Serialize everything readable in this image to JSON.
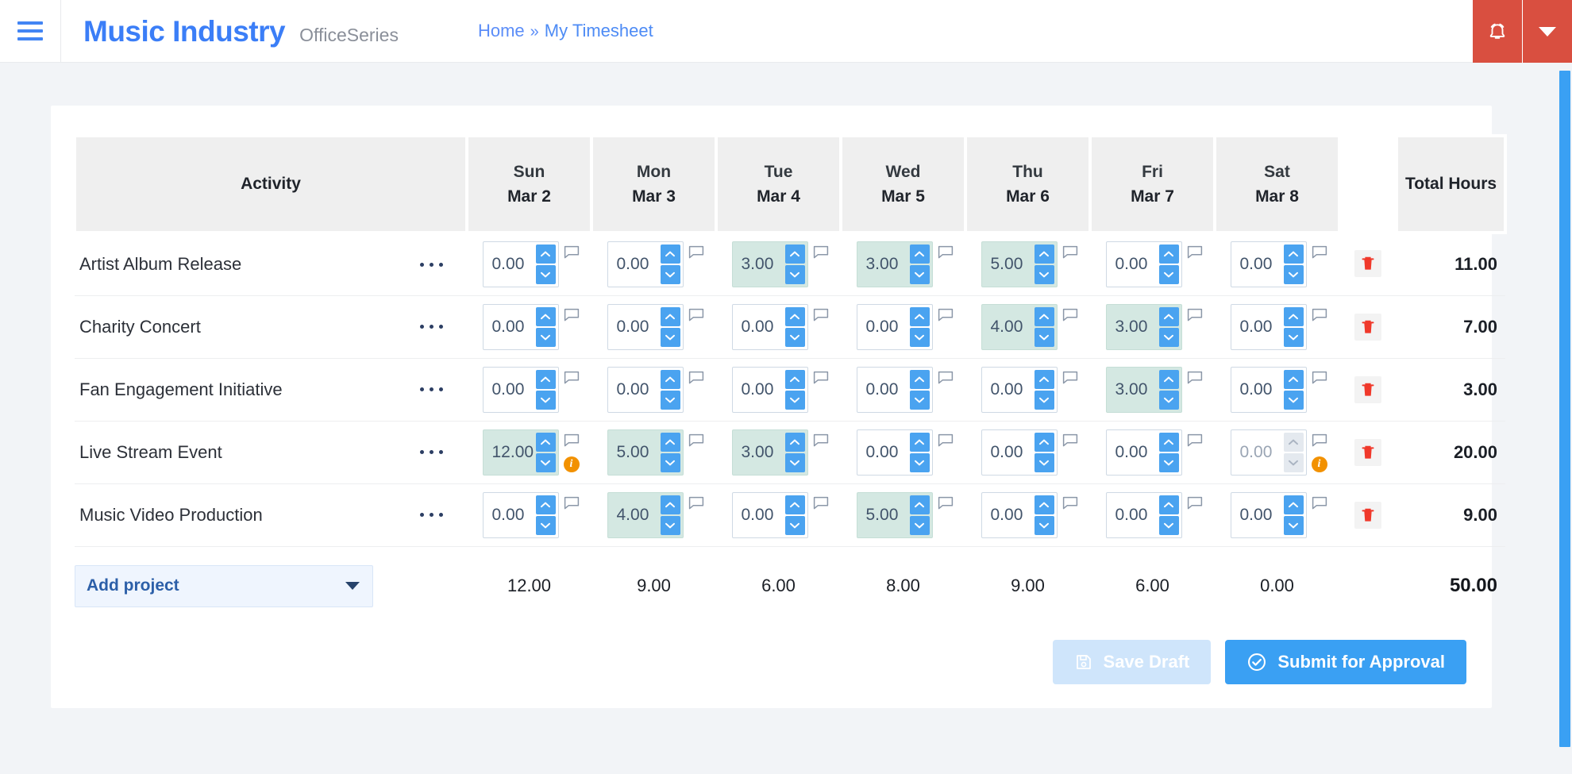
{
  "topbar": {
    "menu_icon": "hamburger-icon",
    "brand_title": "Music Industry",
    "brand_sub": "OfficeSeries",
    "breadcrumb": {
      "home": "Home",
      "separator": "»",
      "current": "My Timesheet"
    },
    "alert_icon": "alarm-bell-icon",
    "alert_caret_icon": "chevron-down-icon",
    "alert_color": "#d94f40"
  },
  "table": {
    "activity_header": "Activity",
    "total_header": "Total Hours",
    "days": [
      {
        "dow": "Sun",
        "date": "Mar 2"
      },
      {
        "dow": "Mon",
        "date": "Mar 3"
      },
      {
        "dow": "Tue",
        "date": "Mar 4"
      },
      {
        "dow": "Wed",
        "date": "Mar 5"
      },
      {
        "dow": "Thu",
        "date": "Mar 6"
      },
      {
        "dow": "Fri",
        "date": "Mar 7"
      },
      {
        "dow": "Sat",
        "date": "Mar 8"
      }
    ],
    "rows": [
      {
        "activity": "Artist Album Release",
        "hours": [
          {
            "value": "0.00",
            "filled": false,
            "disabled": false,
            "warn": false
          },
          {
            "value": "0.00",
            "filled": false,
            "disabled": false,
            "warn": false
          },
          {
            "value": "3.00",
            "filled": true,
            "disabled": false,
            "warn": false
          },
          {
            "value": "3.00",
            "filled": true,
            "disabled": false,
            "warn": false
          },
          {
            "value": "5.00",
            "filled": true,
            "disabled": false,
            "warn": false
          },
          {
            "value": "0.00",
            "filled": false,
            "disabled": false,
            "warn": false
          },
          {
            "value": "0.00",
            "filled": false,
            "disabled": false,
            "warn": false
          }
        ],
        "total": "11.00"
      },
      {
        "activity": "Charity Concert",
        "hours": [
          {
            "value": "0.00",
            "filled": false,
            "disabled": false,
            "warn": false
          },
          {
            "value": "0.00",
            "filled": false,
            "disabled": false,
            "warn": false
          },
          {
            "value": "0.00",
            "filled": false,
            "disabled": false,
            "warn": false
          },
          {
            "value": "0.00",
            "filled": false,
            "disabled": false,
            "warn": false
          },
          {
            "value": "4.00",
            "filled": true,
            "disabled": false,
            "warn": false
          },
          {
            "value": "3.00",
            "filled": true,
            "disabled": false,
            "warn": false
          },
          {
            "value": "0.00",
            "filled": false,
            "disabled": false,
            "warn": false
          }
        ],
        "total": "7.00"
      },
      {
        "activity": "Fan Engagement Initiative",
        "hours": [
          {
            "value": "0.00",
            "filled": false,
            "disabled": false,
            "warn": false
          },
          {
            "value": "0.00",
            "filled": false,
            "disabled": false,
            "warn": false
          },
          {
            "value": "0.00",
            "filled": false,
            "disabled": false,
            "warn": false
          },
          {
            "value": "0.00",
            "filled": false,
            "disabled": false,
            "warn": false
          },
          {
            "value": "0.00",
            "filled": false,
            "disabled": false,
            "warn": false
          },
          {
            "value": "3.00",
            "filled": true,
            "disabled": false,
            "warn": false
          },
          {
            "value": "0.00",
            "filled": false,
            "disabled": false,
            "warn": false
          }
        ],
        "total": "3.00"
      },
      {
        "activity": "Live Stream Event",
        "hours": [
          {
            "value": "12.00",
            "filled": true,
            "disabled": false,
            "warn": true
          },
          {
            "value": "5.00",
            "filled": true,
            "disabled": false,
            "warn": false
          },
          {
            "value": "3.00",
            "filled": true,
            "disabled": false,
            "warn": false
          },
          {
            "value": "0.00",
            "filled": false,
            "disabled": false,
            "warn": false
          },
          {
            "value": "0.00",
            "filled": false,
            "disabled": false,
            "warn": false
          },
          {
            "value": "0.00",
            "filled": false,
            "disabled": false,
            "warn": false
          },
          {
            "value": "0.00",
            "filled": false,
            "disabled": true,
            "warn": true
          }
        ],
        "total": "20.00"
      },
      {
        "activity": "Music Video Production",
        "hours": [
          {
            "value": "0.00",
            "filled": false,
            "disabled": false,
            "warn": false
          },
          {
            "value": "4.00",
            "filled": true,
            "disabled": false,
            "warn": false
          },
          {
            "value": "0.00",
            "filled": false,
            "disabled": false,
            "warn": false
          },
          {
            "value": "5.00",
            "filled": true,
            "disabled": false,
            "warn": false
          },
          {
            "value": "0.00",
            "filled": false,
            "disabled": false,
            "warn": false
          },
          {
            "value": "0.00",
            "filled": false,
            "disabled": false,
            "warn": false
          },
          {
            "value": "0.00",
            "filled": false,
            "disabled": false,
            "warn": false
          }
        ],
        "total": "9.00"
      }
    ],
    "footer": {
      "add_project_label": "Add project",
      "day_totals": [
        "12.00",
        "9.00",
        "6.00",
        "8.00",
        "9.00",
        "6.00",
        "0.00"
      ],
      "grand_total": "50.00"
    }
  },
  "actions": {
    "save_draft_label": "Save Draft",
    "save_draft_icon": "save-disk-icon",
    "save_draft_disabled": true,
    "submit_label": "Submit for Approval",
    "submit_icon": "check-circle-icon",
    "submit_color": "#3aa0f3"
  },
  "icons": {
    "row_menu": "ellipsis-icon",
    "note": "comment-flag-icon",
    "warn": "info-badge-icon",
    "delete": "trash-icon",
    "spin_up": "chevron-up-icon",
    "spin_down": "chevron-down-icon"
  }
}
